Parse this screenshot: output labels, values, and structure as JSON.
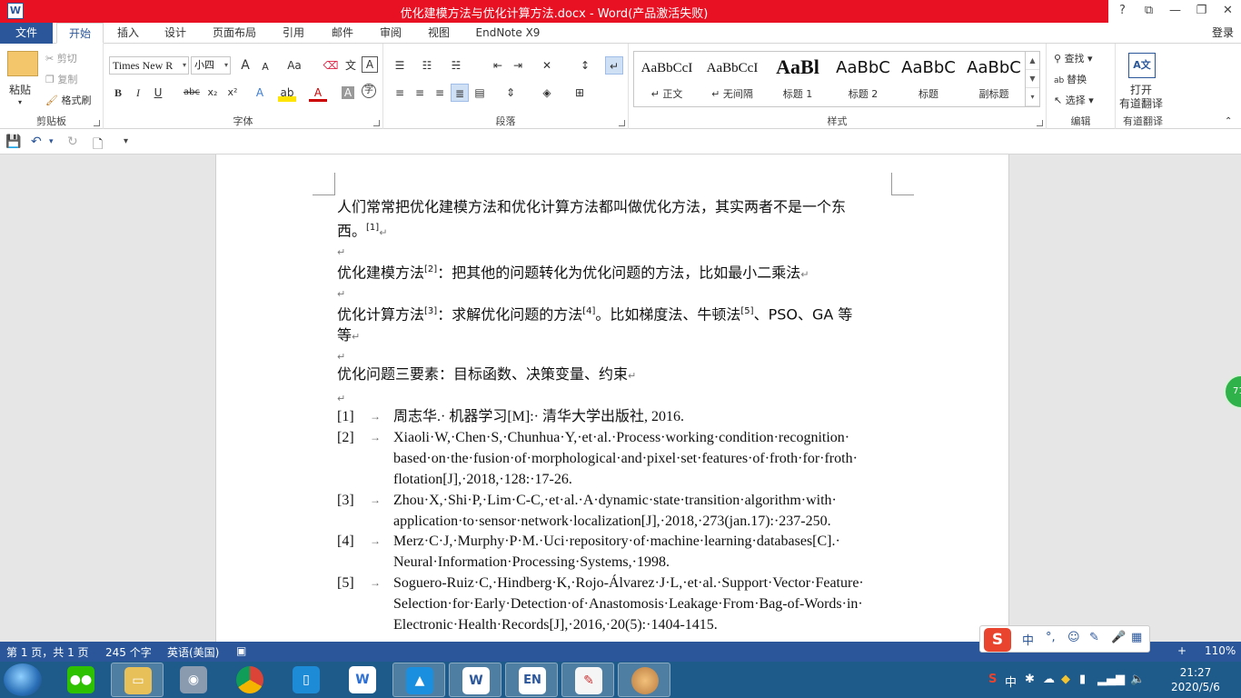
{
  "window": {
    "title": "优化建模方法与优化计算方法.docx -  Word(产品激活失败)",
    "app_icon": "W",
    "controls": [
      "?",
      "⧉",
      "—",
      "❐",
      "✕"
    ]
  },
  "tabs": {
    "file": "文件",
    "items": [
      "开始",
      "插入",
      "设计",
      "页面布局",
      "引用",
      "邮件",
      "审阅",
      "视图",
      "EndNote X9"
    ],
    "login": "登录"
  },
  "ribbon": {
    "clipboard": {
      "label": "剪贴板",
      "paste": "粘贴",
      "cut": "剪切",
      "copy": "复制",
      "format_painter": "格式刷"
    },
    "font": {
      "label": "字体",
      "font_name": "Times New R",
      "font_size": "小四",
      "grow": "A",
      "shrink": "A",
      "case": "Aa",
      "bold": "B",
      "italic": "I",
      "underline": "U",
      "strike": "abc",
      "sub": "x₂",
      "sup": "x²"
    },
    "paragraph": {
      "label": "段落"
    },
    "styles": {
      "label": "样式",
      "items": [
        {
          "sample": "AaBbCcI",
          "name": "↵ 正文"
        },
        {
          "sample": "AaBbCcI",
          "name": "↵ 无间隔"
        },
        {
          "sample": "AaBl",
          "name": "标题 1"
        },
        {
          "sample": "AaBbC",
          "name": "标题 2"
        },
        {
          "sample": "AaBbC",
          "name": "标题"
        },
        {
          "sample": "AaBbC",
          "name": "副标题"
        }
      ]
    },
    "editing": {
      "label": "编辑",
      "find": "查找",
      "replace": "替换",
      "select": "选择"
    },
    "youdao": {
      "label": "有道翻译",
      "open_line1": "打开",
      "open_line2": "有道翻译"
    }
  },
  "document": {
    "paragraphs": {
      "p1_line1": "人们常常把优化建模方法和优化计算方法都叫做优化方法，其实两者不是一个东",
      "p1_line2": "西。",
      "p1_cite": "[1]",
      "p2_text": "优化建模方法",
      "p2_cite": "[2]",
      "p2_rest": "：把其他的问题转化为优化问题的方法，比如最小二乘法",
      "p3_text": "优化计算方法",
      "p3_cite": "[3]",
      "p3_mid": "：求解优化问题的方法",
      "p3_cite2": "[4]",
      "p3_mid2": "。比如梯度法、牛顿法",
      "p3_cite3": "[5]",
      "p3_rest": "、PSO、GA 等",
      "p3_line2": "等",
      "p4_text": "优化问题三要素：目标函数、决策变量、约束"
    },
    "references": [
      {
        "num": "[1]",
        "text": "周志华.· 机器学习[M]:· 清华大学出版社, 2016."
      },
      {
        "num": "[2]",
        "text": "Xiaoli·W,·Chen·S,·Chunhua·Y,·et·al.·Process·working·condition·recognition· based·on·the·fusion·of·morphological·and·pixel·set·features·of·froth·for·froth· flotation[J],·2018,·128:·17-26."
      },
      {
        "num": "[3]",
        "text": "Zhou·X,·Shi·P,·Lim·C-C,·et·al.·A·dynamic·state·transition·algorithm·with· application·to·sensor·network·localization[J],·2018,·273(jan.17):·237-250."
      },
      {
        "num": "[4]",
        "text": "Merz·C·J,·Murphy·P·M.·Uci·repository·of·machine·learning·databases[C].· Neural·Information·Processing·Systems,·1998."
      },
      {
        "num": "[5]",
        "text": "Soguero-Ruiz·C,·Hindberg·K,·Rojo-Álvarez·J·L,·et·al.·Support·Vector·Feature· Selection·for·Early·Detection·of·Anastomosis·Leakage·From·Bag-of-Words·in· Electronic·Health·Records[J],·2016,·20(5):·1404-1415."
      }
    ]
  },
  "bubble": "71",
  "status": {
    "page": "第 1 页，共 1 页",
    "words": "245 个字",
    "lang": "英语(美国)",
    "zoom": "110%",
    "zoom_minus": "−",
    "zoom_plus": "+"
  },
  "ime": {
    "logo": "S",
    "mode": "中",
    "punct": "°,",
    "emoji": "☺",
    "pen": "✎",
    "mic": "🎤",
    "grid": "▦"
  },
  "taskbar": {
    "apps": [
      "wechat",
      "explorer",
      "camera",
      "chrome",
      "reader",
      "wps",
      "cloud",
      "word",
      "endnote",
      "tool",
      "photo"
    ],
    "word_label": "W",
    "endnote_label": "EN",
    "time": "21:27",
    "date": "2020/5/6"
  },
  "colors": {
    "title_red": "#e81123",
    "word_blue": "#2b579a",
    "taskbar": "#1e5a8a"
  }
}
